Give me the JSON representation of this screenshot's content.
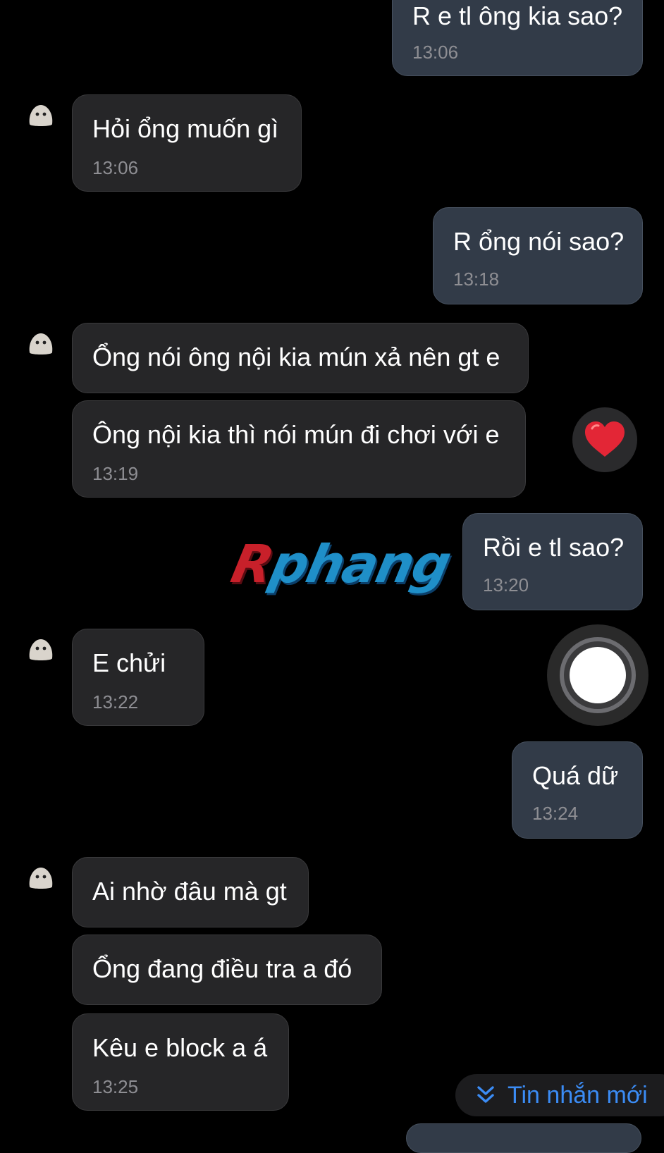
{
  "colors": {
    "background": "#000000",
    "incoming_bubble": "#262628",
    "outgoing_bubble": "#323b48",
    "timestamp": "#8e8e93",
    "accent": "#3b8cf5"
  },
  "messages": [
    {
      "direction": "outgoing",
      "text": "R e tl ông kia sao?",
      "time": "13:06"
    },
    {
      "direction": "incoming",
      "text": "Hỏi ổng muốn gì",
      "time": "13:06"
    },
    {
      "direction": "outgoing",
      "text": "R ổng nói sao?",
      "time": "13:18"
    },
    {
      "direction": "incoming",
      "text": "Ổng nói ông nội kia mún xả nên gt e",
      "time": ""
    },
    {
      "direction": "incoming",
      "text": "Ông nội kia thì nói mún đi chơi với e",
      "time": "13:19",
      "reaction": "❤️"
    },
    {
      "direction": "outgoing",
      "text": "Rồi e tl sao?",
      "time": "13:20"
    },
    {
      "direction": "incoming",
      "text": "E chửi",
      "time": "13:22"
    },
    {
      "direction": "outgoing",
      "text": "Quá dữ",
      "time": "13:24"
    },
    {
      "direction": "incoming",
      "text": "Ai nhờ đâu mà gt",
      "time": ""
    },
    {
      "direction": "incoming",
      "text": "Ổng đang điều tra a đó",
      "time": ""
    },
    {
      "direction": "incoming",
      "text": "Kêu e block a á",
      "time": "13:25"
    }
  ],
  "watermark": {
    "first": "R",
    "rest": "phang"
  },
  "new_messages_button": {
    "label": "Tin nhắn mới",
    "icon": "double-chevron-down-icon"
  },
  "record_button": {
    "icon": "record-circle-icon"
  }
}
